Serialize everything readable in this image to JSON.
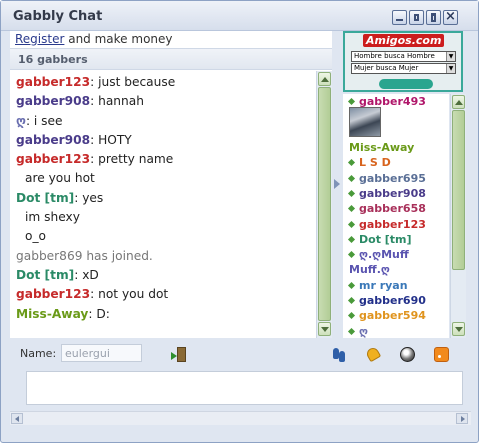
{
  "window": {
    "title": "Gabbly Chat"
  },
  "header": {
    "register_link": "Register",
    "register_text": " and make money",
    "gabbers_count": "16 gabbers"
  },
  "messages": [
    {
      "nick": "gabber123",
      "color": "#c62a2a",
      "sep": ": ",
      "text": "just because",
      "type": "chat"
    },
    {
      "nick": "gabber908",
      "color": "#4a3c8a",
      "sep": ": ",
      "text": "hannah",
      "type": "chat"
    },
    {
      "nick": "ღ",
      "color": "#6a6fb0",
      "sep": ": ",
      "text": "i see",
      "type": "chat"
    },
    {
      "nick": "gabber908",
      "color": "#4a3c8a",
      "sep": ": ",
      "text": "HOTY",
      "type": "chat"
    },
    {
      "nick": "gabber123",
      "color": "#c62a2a",
      "sep": ": ",
      "text": "pretty name",
      "type": "chat"
    },
    {
      "nick": "",
      "color": "#222222",
      "sep": "",
      "text": "are you hot",
      "type": "indent"
    },
    {
      "nick": "Dot [tm]",
      "color": "#2a8a66",
      "sep": ": ",
      "text": "yes",
      "type": "chat"
    },
    {
      "nick": "",
      "color": "#222222",
      "sep": "",
      "text": "im shexy",
      "type": "indent"
    },
    {
      "nick": "",
      "color": "#222222",
      "sep": "",
      "text": "o_o",
      "type": "indent"
    },
    {
      "nick": "",
      "color": "#777777",
      "sep": "",
      "text": "gabber869 has joined.",
      "type": "system"
    },
    {
      "nick": "Dot [tm]",
      "color": "#2a8a66",
      "sep": ": ",
      "text": "xD",
      "type": "chat"
    },
    {
      "nick": "gabber123",
      "color": "#c62a2a",
      "sep": ": ",
      "text": "not you dot",
      "type": "chat"
    },
    {
      "nick": "Miss-Away",
      "color": "#6a9a18",
      "sep": ": ",
      "text": "D:",
      "type": "chat"
    }
  ],
  "ad": {
    "brand": "Amigos.com",
    "option_1": "Hombre busca Hombre",
    "option_2": "Mujer busca Mujer",
    "accent": "#3aa89a"
  },
  "users": [
    {
      "name": "gabber493",
      "color": "#b0166a",
      "dot": true
    },
    {
      "name": "Miss-Away",
      "color": "#6a9a18",
      "dot": false,
      "avatar": true
    },
    {
      "name": "L S D",
      "color": "#d8641e",
      "dot": true
    },
    {
      "name": "gabber695",
      "color": "#5a6f96",
      "dot": true
    },
    {
      "name": "gabber908",
      "color": "#4a3c8a",
      "dot": true
    },
    {
      "name": "gabber658",
      "color": "#a8305a",
      "dot": true
    },
    {
      "name": "gabber123",
      "color": "#c62a2a",
      "dot": true
    },
    {
      "name": "Dot [tm]",
      "color": "#2a8a66",
      "dot": true
    },
    {
      "name": "ღ.ღMuff",
      "color": "#5a54b0",
      "dot": true
    },
    {
      "name": "Muff.ღ",
      "color": "#5a54b0",
      "dot": false
    },
    {
      "name": "mr ryan",
      "color": "#3a78b8",
      "dot": true
    },
    {
      "name": "gabber690",
      "color": "#22308a",
      "dot": true
    },
    {
      "name": "gabber594",
      "color": "#e0941e",
      "dot": true
    },
    {
      "name": "ღ",
      "color": "#6a6fb0",
      "dot": true
    }
  ],
  "composer": {
    "name_label": "Name:",
    "name_value": "eulergui"
  },
  "icons": {
    "leave": "door-exit-icon",
    "footsteps": "footsteps-icon",
    "bell": "bell-icon",
    "smiley": "smiley-icon",
    "rss": "rss-feed-icon"
  }
}
